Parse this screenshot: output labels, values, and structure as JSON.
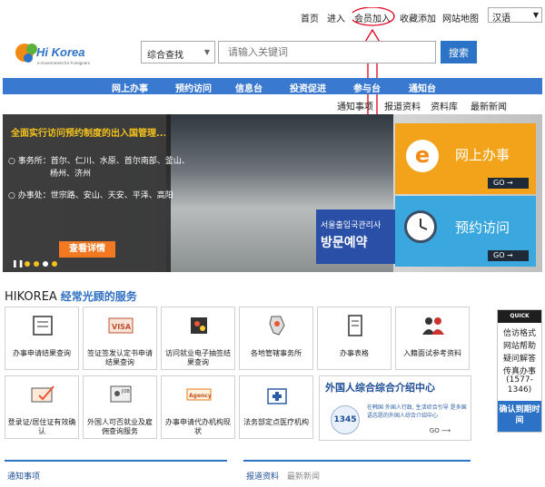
{
  "top_links": [
    "首页",
    "进入",
    "会员加入",
    "收藏添加",
    "网站地图"
  ],
  "language": "汉语",
  "logo": {
    "brand": "Hi Korea",
    "tagline": "e-Government for Foreigners"
  },
  "search": {
    "category": "综合查找",
    "placeholder": "请输入关键词",
    "button": "搜索"
  },
  "nav": [
    "网上办事",
    "预约访问",
    "信息台",
    "投资促进",
    "参与台",
    "通知台"
  ],
  "subnav": [
    "通知事项",
    "报道资料",
    "资料库",
    "最新新闻"
  ],
  "hero": {
    "title": "全面实行访问预约制度的出入国管理...",
    "lines": [
      "事务所：首尔、仁川、水原、首尔南部、釜山、",
      "杨州、济州",
      "办事处：世宗路、安山、天安、平泽、高阳"
    ],
    "button": "查看详情",
    "sign_line1": "서울출입국관리사",
    "sign_line2": "방문예약"
  },
  "tiles": [
    {
      "icon_char": "e",
      "label": "网上办事",
      "go": "GO"
    },
    {
      "label": "预约访问",
      "go": "GO"
    }
  ],
  "section": {
    "brand": "HIKOREA",
    "title": "经常光顾的服务"
  },
  "services": [
    "办事申请结果查询",
    "签证签发认定书申请结果查询",
    "访问就业电子抽签结果查询",
    "各地管辖事务所",
    "办事表格",
    "入籍面试参考资料",
    "登录证/居住证有效确认",
    "外国人可否就业及雇佣查询服务",
    "办事申请代办机构现状",
    "法务部定点医疗机构"
  ],
  "card_badges": {
    "visa": "VISA",
    "job": "JOB",
    "agency": "Agency"
  },
  "center": {
    "title": "外国人综合综合介绍中心",
    "number": "1345",
    "desc": "在韩国 外国人行政, 生活综合引导 是多国语志愿的外国人综合介绍中心",
    "go": "GO"
  },
  "quick": {
    "header": "QUICK",
    "items": [
      "信访格式",
      "网站帮助",
      "疑问解答",
      "传真办事",
      "(1577-",
      "1346)"
    ],
    "button": "确认到期时间"
  },
  "bottom_tabs": [
    "通知事项",
    "报道资料",
    "最新新闻"
  ],
  "colors": {
    "primary": "#2c72c7",
    "orange": "#f28a14",
    "teal": "#3aa8df",
    "annotation": "#e0001b"
  }
}
